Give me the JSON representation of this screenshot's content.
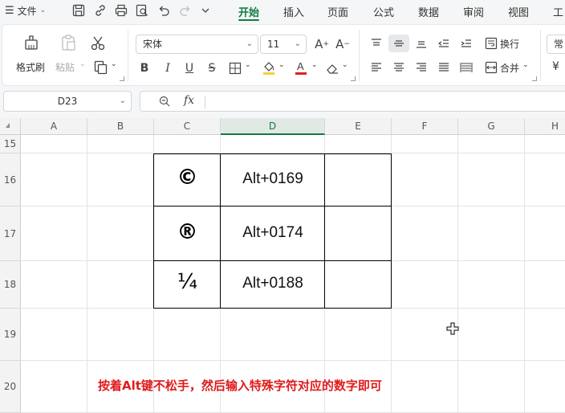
{
  "menubar": {
    "file_label": "文件",
    "tabs": [
      "开始",
      "插入",
      "页面",
      "公式",
      "数据",
      "审阅",
      "视图",
      "工"
    ],
    "active_tab": "开始"
  },
  "ribbon": {
    "format_painter": "格式刷",
    "paste": "粘贴",
    "font_name": "宋体",
    "font_size": "11",
    "wrap": "换行",
    "merge": "合并",
    "number_format": "常"
  },
  "formula_bar": {
    "cell_ref": "D23",
    "fx": "fx",
    "value": ""
  },
  "sheet": {
    "columns": [
      "A",
      "B",
      "C",
      "D",
      "E",
      "F",
      "G",
      "H"
    ],
    "rows": [
      "15",
      "16",
      "17",
      "18",
      "19",
      "20"
    ],
    "selected_column": "D",
    "table": [
      {
        "symbol": "©",
        "code": "Alt+0169"
      },
      {
        "symbol": "®",
        "code": "Alt+0174"
      },
      {
        "symbol": "¼",
        "code": "Alt+0188"
      }
    ],
    "caption": "按着Alt键不松手，然后输入特殊字符对应的数字即可"
  },
  "colors": {
    "accent": "#107c41",
    "caption": "#e01b1b"
  }
}
